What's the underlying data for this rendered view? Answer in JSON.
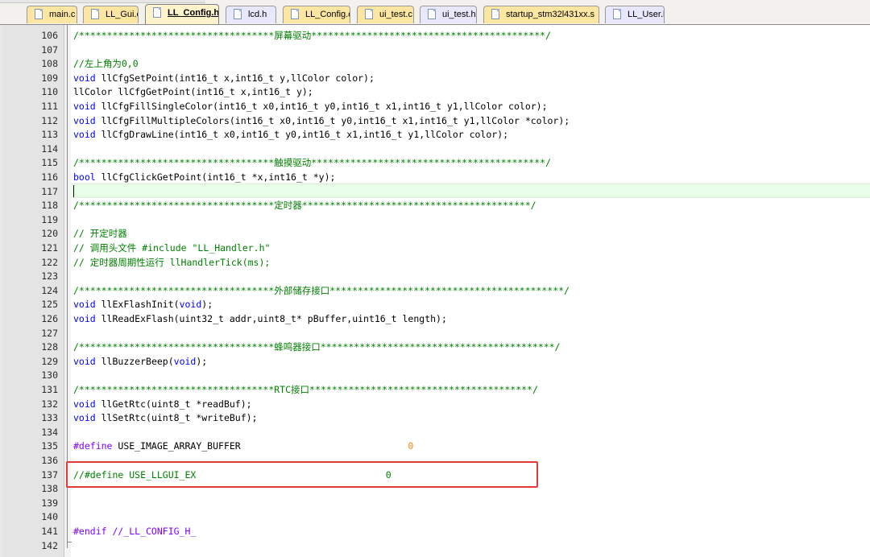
{
  "tabs": [
    {
      "label": "main.c",
      "kind": "src"
    },
    {
      "label": "LL_Gui.c",
      "kind": "src"
    },
    {
      "label": "LL_Config.h",
      "kind": "hdr",
      "active": true
    },
    {
      "label": "lcd.h",
      "kind": "hdr"
    },
    {
      "label": "LL_Config.c",
      "kind": "src"
    },
    {
      "label": "ui_test.c",
      "kind": "src"
    },
    {
      "label": "ui_test.h",
      "kind": "hdr"
    },
    {
      "label": "startup_stm32l431xx.s",
      "kind": "src"
    },
    {
      "label": "LL_User.h",
      "kind": "hdr"
    }
  ],
  "editor": {
    "first_line": 106,
    "current_line": 117,
    "highlighted_line": 137,
    "lines": [
      [
        {
          "t": "/***********************************屏幕驱动******************************************/",
          "c": "comment"
        }
      ],
      [],
      [
        {
          "t": "//左上角为0,0",
          "c": "comment"
        }
      ],
      [
        {
          "t": "void",
          "c": "kw"
        },
        {
          "t": " llCfgSetPoint(int16_t x,int16_t y,llColor color);"
        }
      ],
      [
        {
          "t": "llColor llCfgGetPoint(int16_t x,int16_t y);"
        }
      ],
      [
        {
          "t": "void",
          "c": "kw"
        },
        {
          "t": " llCfgFillSingleColor(int16_t x0,int16_t y0,int16_t x1,int16_t y1,llColor color);"
        }
      ],
      [
        {
          "t": "void",
          "c": "kw"
        },
        {
          "t": " llCfgFillMultipleColors(int16_t x0,int16_t y0,int16_t x1,int16_t y1,llColor *color);"
        }
      ],
      [
        {
          "t": "void",
          "c": "kw"
        },
        {
          "t": " llCfgDrawLine(int16_t x0,int16_t y0,int16_t x1,int16_t y1,llColor color);"
        }
      ],
      [],
      [
        {
          "t": "/***********************************触摸驱动******************************************/",
          "c": "comment"
        }
      ],
      [
        {
          "t": "bool",
          "c": "kw"
        },
        {
          "t": " llCfgClickGetPoint(int16_t *x,int16_t *y);"
        }
      ],
      [],
      [
        {
          "t": "/***********************************定时器*****************************************/",
          "c": "comment"
        }
      ],
      [],
      [
        {
          "t": "// 开定时器",
          "c": "comment"
        }
      ],
      [
        {
          "t": "// 调用头文件 #include \"LL_Handler.h\"",
          "c": "comment"
        }
      ],
      [
        {
          "t": "// 定时器周期性运行 llHandlerTick(ms);",
          "c": "comment"
        }
      ],
      [],
      [
        {
          "t": "/***********************************外部储存接口******************************************/",
          "c": "comment"
        }
      ],
      [
        {
          "t": "void",
          "c": "kw"
        },
        {
          "t": " llExFlashInit("
        },
        {
          "t": "void",
          "c": "kw"
        },
        {
          "t": ");"
        }
      ],
      [
        {
          "t": "void",
          "c": "kw"
        },
        {
          "t": " llReadExFlash(uint32_t addr,uint8_t* pBuffer,uint16_t length);"
        }
      ],
      [],
      [
        {
          "t": "/***********************************蜂鸣器接口******************************************/",
          "c": "comment"
        }
      ],
      [
        {
          "t": "void",
          "c": "kw"
        },
        {
          "t": " llBuzzerBeep("
        },
        {
          "t": "void",
          "c": "kw"
        },
        {
          "t": ");"
        }
      ],
      [],
      [
        {
          "t": "/***********************************RTC接口****************************************/",
          "c": "comment"
        }
      ],
      [
        {
          "t": "void",
          "c": "kw"
        },
        {
          "t": " llGetRtc(uint8_t *readBuf);"
        }
      ],
      [
        {
          "t": "void",
          "c": "kw"
        },
        {
          "t": " llSetRtc(uint8_t *writeBuf);"
        }
      ],
      [],
      [
        {
          "t": "#define",
          "c": "pp"
        },
        {
          "t": " USE_IMAGE_ARRAY_BUFFER                              "
        },
        {
          "t": "0",
          "c": "num"
        }
      ],
      [],
      [
        {
          "t": "//#define USE_LLGUI_EX                                  0",
          "c": "comment"
        }
      ],
      [],
      [],
      [],
      [
        {
          "t": "#endif //_LL_CONFIG_H_",
          "c": "pp"
        }
      ],
      []
    ]
  }
}
